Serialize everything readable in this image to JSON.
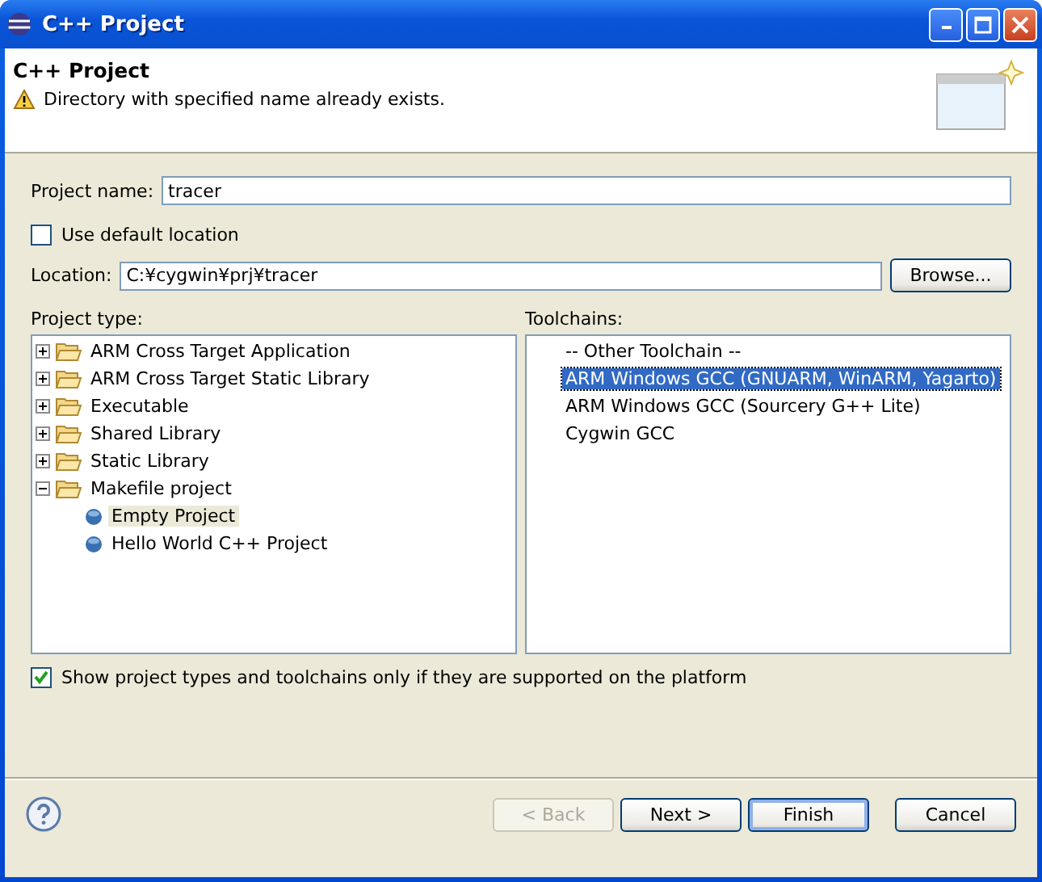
{
  "window": {
    "title": "C++ Project"
  },
  "header": {
    "title": "C++ Project",
    "message": "Directory with specified name already exists."
  },
  "project_name": {
    "label": "Project name:",
    "value": "tracer"
  },
  "use_default_location": {
    "label": "Use default location",
    "checked": false
  },
  "location": {
    "label": "Location:",
    "value": "C:¥cygwin¥prj¥tracer",
    "button": "Browse..."
  },
  "project_type": {
    "label": "Project type:",
    "items": [
      {
        "label": "ARM Cross Target Application",
        "expanded": false,
        "selected": false
      },
      {
        "label": "ARM Cross Target Static Library",
        "expanded": false,
        "selected": false
      },
      {
        "label": "Executable",
        "expanded": false,
        "selected": false
      },
      {
        "label": "Shared Library",
        "expanded": false,
        "selected": false
      },
      {
        "label": "Static Library",
        "expanded": false,
        "selected": false
      },
      {
        "label": "Makefile project",
        "expanded": true,
        "selected": false,
        "children": [
          {
            "label": "Empty Project",
            "selected": true
          },
          {
            "label": "Hello World C++ Project",
            "selected": false
          }
        ]
      }
    ]
  },
  "toolchains": {
    "label": "Toolchains:",
    "items": [
      {
        "label": "-- Other Toolchain --",
        "selected": false
      },
      {
        "label": "ARM Windows GCC (GNUARM, WinARM, Yagarto)",
        "selected": true
      },
      {
        "label": "ARM Windows GCC (Sourcery G++ Lite)",
        "selected": false
      },
      {
        "label": "Cygwin GCC",
        "selected": false
      }
    ]
  },
  "show_supported": {
    "label": "Show project types and toolchains only if they are supported on the platform",
    "checked": true
  },
  "buttons": [
    {
      "label": "< Back",
      "disabled": true,
      "default": false
    },
    {
      "label": "Next >",
      "disabled": false,
      "default": false
    },
    {
      "label": "Finish",
      "disabled": false,
      "default": true
    },
    {
      "label": "Cancel",
      "disabled": false,
      "default": false
    }
  ]
}
